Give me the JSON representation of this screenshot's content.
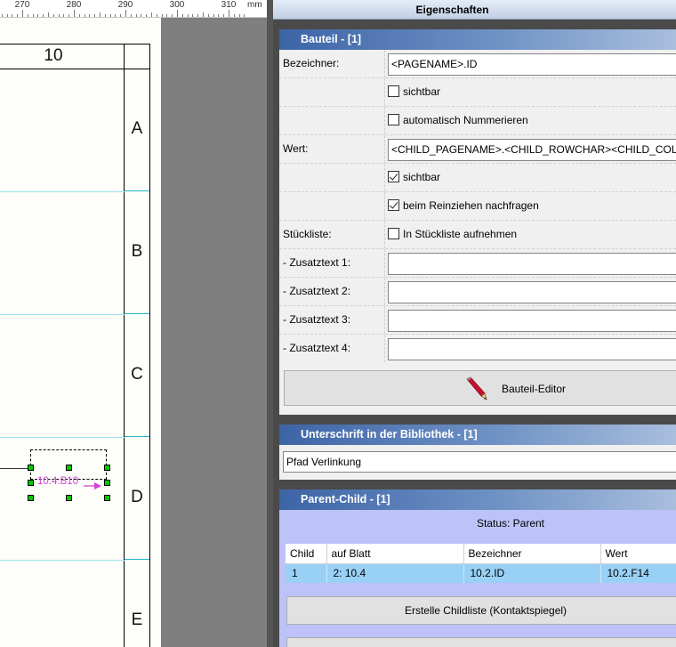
{
  "ruler": {
    "ticks": [
      "270",
      "280",
      "290",
      "300",
      "310"
    ],
    "unit": "mm"
  },
  "drawing": {
    "column_label": "10",
    "row_labels": [
      "A",
      "B",
      "C",
      "D",
      "E"
    ],
    "reference_text": "10.4.B10"
  },
  "panel": {
    "title": "Eigenschaften",
    "bauteil": {
      "header": "Bauteil  -  [1]",
      "bezeichner_label": "Bezeichner:",
      "bezeichner_value": "<PAGENAME>.ID",
      "bezeichner_sichtbar": "sichtbar",
      "bezeichner_sichtbar_checked": false,
      "auto_nummerieren": "automatisch Nummerieren",
      "auto_nummerieren_checked": false,
      "wert_label": "Wert:",
      "wert_value": "<CHILD_PAGENAME>.<CHILD_ROWCHAR><CHILD_COLNUM>",
      "wert_sichtbar": "sichtbar",
      "wert_sichtbar_checked": true,
      "reinziehen": "beim Reinziehen nachfragen",
      "reinziehen_checked": true,
      "stueckliste_label": "Stückliste:",
      "stueckliste_check": "In Stückliste aufnehmen",
      "stueckliste_checked": false,
      "zusatztext1_label": " - Zusatztext 1:",
      "zusatztext2_label": " - Zusatztext 2:",
      "zusatztext3_label": " - Zusatztext 3:",
      "zusatztext4_label": " - Zusatztext 4:",
      "zusatztext1_value": "",
      "zusatztext2_value": "",
      "zusatztext3_value": "",
      "zusatztext4_value": "",
      "editor_button": "Bauteil-Editor"
    },
    "unterschrift": {
      "header": "Unterschrift in der Bibliothek  -  [1]",
      "pfad_value": "Pfad Verlinkung"
    },
    "parent_child": {
      "header": "Parent-Child  -  [1]",
      "status": "Status: Parent",
      "columns": [
        "Child",
        "auf Blatt",
        "Bezeichner",
        "Wert"
      ],
      "rows": [
        [
          "1",
          "2: 10.4",
          "10.2.ID",
          "10.2.F14"
        ]
      ],
      "childliste_button": "Erstelle Childliste (Kontaktspiegel)"
    }
  }
}
